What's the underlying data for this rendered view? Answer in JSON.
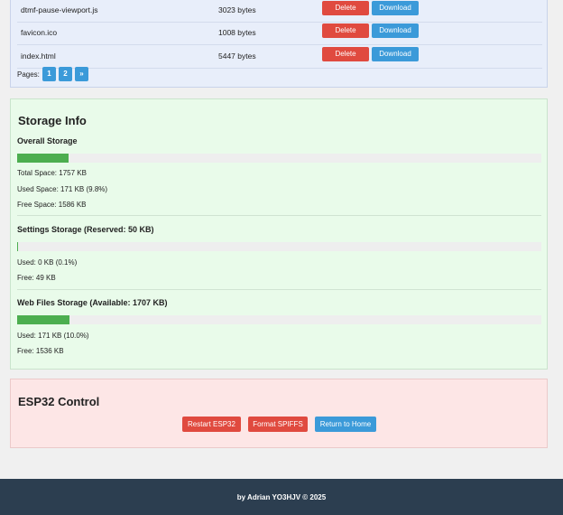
{
  "files": [
    {
      "name": "dtmf-pause-viewport.js",
      "size": "3023 bytes"
    },
    {
      "name": "favicon.ico",
      "size": "1008 bytes"
    },
    {
      "name": "index.html",
      "size": "5447 bytes"
    }
  ],
  "file_actions": {
    "delete_label": "Delete",
    "download_label": "Download"
  },
  "pagination": {
    "label": "Pages:",
    "pages": [
      "1",
      "2"
    ],
    "next": "»"
  },
  "storage": {
    "title": "Storage Info",
    "overall": {
      "title": "Overall Storage",
      "percent": 9.8,
      "total": "Total Space: 1757 KB",
      "used": "Used Space: 171 KB (9.8%)",
      "free": "Free Space: 1586 KB"
    },
    "settings": {
      "title": "Settings Storage (Reserved: 50 KB)",
      "percent": 0.1,
      "used": "Used: 0 KB (0.1%)",
      "free": "Free: 49 KB"
    },
    "web": {
      "title": "Web Files Storage (Available: 1707 KB)",
      "percent": 10.0,
      "used": "Used: 171 KB (10.0%)",
      "free": "Free: 1536 KB"
    }
  },
  "esp_control": {
    "title": "ESP32 Control",
    "restart_label": "Restart ESP32",
    "format_label": "Format SPIFFS",
    "home_label": "Return to Home"
  },
  "footer": {
    "text": "by Adrian YO3HJV © 2025"
  },
  "colors": {
    "danger": "#e04a3f",
    "primary": "#3b9ad9",
    "success": "#4cae4f",
    "footer_bg": "#2c3e50"
  }
}
